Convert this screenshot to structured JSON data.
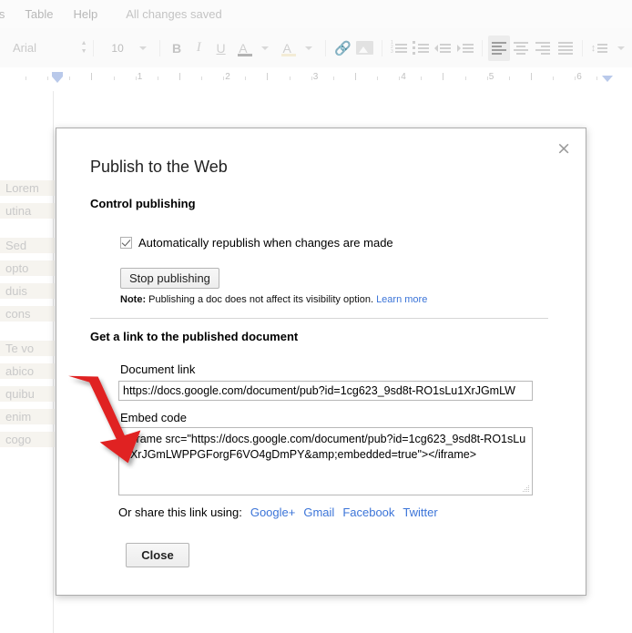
{
  "menubar": {
    "items": [
      {
        "label": "ls",
        "name": "menu-tools"
      },
      {
        "label": "Table",
        "name": "menu-table"
      },
      {
        "label": "Help",
        "name": "menu-help"
      }
    ],
    "save_status": "All changes saved"
  },
  "toolbar": {
    "font_name": "Arial",
    "font_size": "10",
    "bold": "B",
    "italic": "I",
    "underline": "U",
    "text_color": "A",
    "highlight_color": "A",
    "link_icon": "⚭",
    "image_icon": "image-icon",
    "numbered_list": "1 2 3",
    "bulleted_list": "bullets",
    "decrease_indent": "decrease-indent",
    "increase_indent": "increase-indent",
    "align_left": "align-left",
    "align_center": "align-center",
    "align_right": "align-right",
    "align_justify": "align-justify",
    "line_spacing": "line-spacing"
  },
  "ruler": {
    "numbers": [
      "1",
      "2",
      "3",
      "4",
      "5",
      "6"
    ]
  },
  "document": {
    "lines": [
      "Lorem",
      "utina",
      "",
      "Sed",
      "opto",
      "duis",
      "cons",
      "",
      "Te vo",
      "abico",
      "quibu",
      "enim",
      "cogo"
    ]
  },
  "dialog": {
    "title": "Publish to the Web",
    "close_icon": "×",
    "control_section": {
      "heading": "Control publishing",
      "checkbox_label": "Automatically republish when changes are made",
      "checkbox_checked": true,
      "stop_button": "Stop publishing",
      "note_prefix": "Note:",
      "note_text": " Publishing a doc does not affect its visibility option. ",
      "note_link": "Learn more"
    },
    "link_section": {
      "heading": "Get a link to the published document",
      "doc_link_label": "Document link",
      "doc_link_value": "https://docs.google.com/document/pub?id=1cg623_9sd8t-RO1sLu1XrJGmLW",
      "embed_label": "Embed code",
      "embed_value": "<iframe src=\"https://docs.google.com/document/pub?id=1cg623_9sd8t-RO1sLu1XrJGmLWPPGForgF6VO4gDmPY&amp;embedded=true\"></iframe>",
      "share_prompt": "Or share this link using:",
      "share_links": [
        "Google+",
        "Gmail",
        "Facebook",
        "Twitter"
      ]
    },
    "close_button": "Close"
  },
  "annotation": {
    "arrow_color": "#e02020"
  },
  "colors": {
    "link_blue": "#3b74d8",
    "dialog_border": "#acacac",
    "toolbar_bg": "#fafafa"
  }
}
